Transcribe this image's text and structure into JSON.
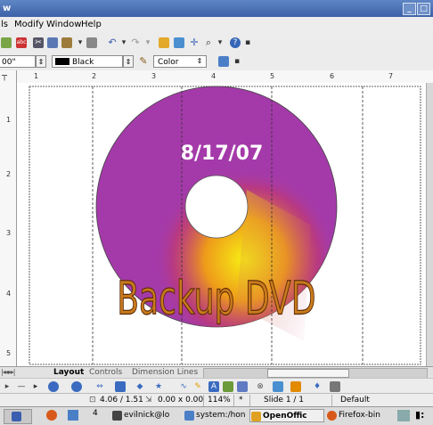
{
  "window": {
    "title_fragment": "w"
  },
  "menu": [
    "ls",
    "Modify",
    "Window",
    "Help"
  ],
  "toolbar2": {
    "width_value": "00\"",
    "line_color": "Black",
    "area_style": "Color"
  },
  "ruler": {
    "h_ticks": [
      "1",
      "2",
      "3",
      "4",
      "5",
      "6",
      "7"
    ],
    "v_ticks": [
      "1",
      "2",
      "3",
      "4",
      "5"
    ]
  },
  "disc": {
    "date_text": "8/17/07",
    "label_text": "Backup DVD",
    "colors": {
      "disc": "#a43aa9",
      "glow_center": "#f7f014",
      "glow_mid": "#e8801c",
      "text_fill": "#c97a1c"
    }
  },
  "tabs": [
    "Layout",
    "Controls",
    "Dimension Lines"
  ],
  "status": {
    "position": "4.06 / 1.51",
    "size": "0.00 x 0.00",
    "zoom": "114%",
    "modified": "*",
    "slide": "Slide 1 / 1",
    "layout": "Default"
  },
  "taskbar": {
    "workspace_num": "4",
    "tasks": [
      "evilnick@lo",
      "system:/hon",
      "OpenOffic",
      "Firefox-bin"
    ]
  }
}
